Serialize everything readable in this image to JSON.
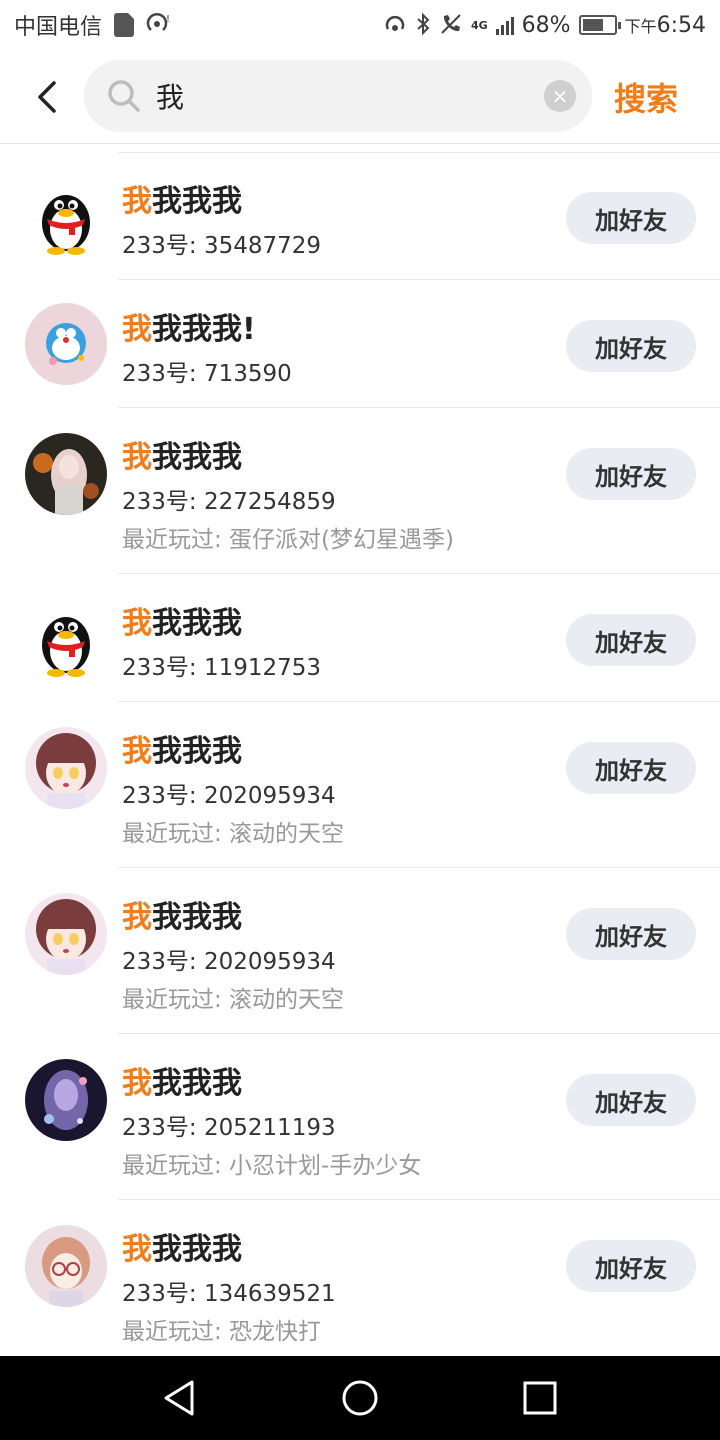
{
  "status_bar": {
    "carrier": "中国电信",
    "network": "4G",
    "battery": "68%",
    "battery_level": 0.68,
    "time_prefix": "下午",
    "time": "6:54"
  },
  "header": {
    "search_value": "我",
    "search_button": "搜索"
  },
  "colors": {
    "accent": "#f07c1a",
    "button_bg": "#eaecf3"
  },
  "results": [
    {
      "name_highlight": "我",
      "name_rest": "我我我",
      "uid": "233号: 35487729",
      "recent": "",
      "avatar": "penguin-avatar",
      "add_label": "加好友"
    },
    {
      "name_highlight": "我",
      "name_rest": "我我我!",
      "uid": "233号: 713590",
      "recent": "",
      "avatar": "doraemon-avatar",
      "add_label": "加好友"
    },
    {
      "name_highlight": "我",
      "name_rest": "我我我",
      "uid": "233号: 227254859",
      "recent": "最近玩过: 蛋仔派对(梦幻星遇季)",
      "avatar": "anime-avatar",
      "add_label": "加好友"
    },
    {
      "name_highlight": "我",
      "name_rest": "我我我",
      "uid": "233号: 11912753",
      "recent": "",
      "avatar": "penguin-avatar",
      "add_label": "加好友"
    },
    {
      "name_highlight": "我",
      "name_rest": "我我我",
      "uid": "233号: 202095934",
      "recent": "最近玩过: 滚动的天空",
      "avatar": "anime-girl-avatar",
      "add_label": "加好友"
    },
    {
      "name_highlight": "我",
      "name_rest": "我我我",
      "uid": "233号: 202095934",
      "recent": "最近玩过: 滚动的天空",
      "avatar": "anime-girl-avatar",
      "add_label": "加好友"
    },
    {
      "name_highlight": "我",
      "name_rest": "我我我",
      "uid": "233号: 205211193",
      "recent": "最近玩过: 小忍计划-手办少女",
      "avatar": "galaxy-avatar",
      "add_label": "加好友"
    },
    {
      "name_highlight": "我",
      "name_rest": "我我我",
      "uid": "233号: 134639521",
      "recent": "最近玩过: 恐龙快打",
      "avatar": "glasses-girl-avatar",
      "add_label": "加好友"
    }
  ]
}
